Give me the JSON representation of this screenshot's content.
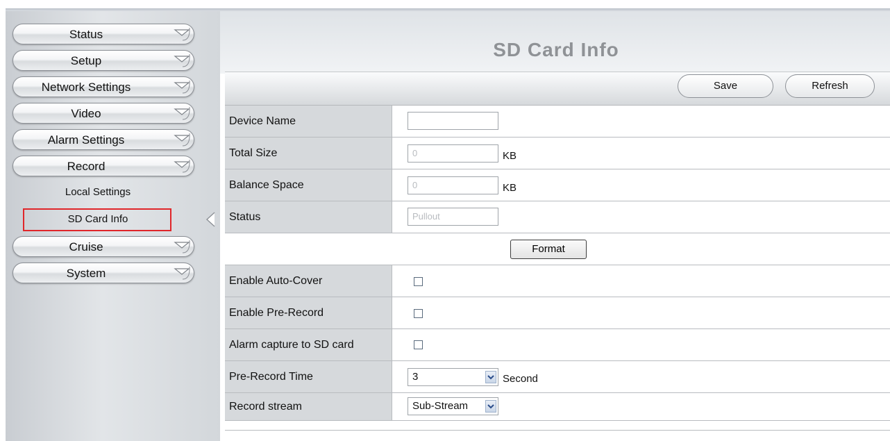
{
  "sidebar": {
    "menu": [
      {
        "label": "Status"
      },
      {
        "label": "Setup"
      },
      {
        "label": "Network Settings"
      },
      {
        "label": "Video"
      },
      {
        "label": "Alarm Settings"
      },
      {
        "label": "Record"
      },
      {
        "label": "Cruise"
      },
      {
        "label": "System"
      }
    ],
    "record_sub": [
      {
        "label": "Local Settings"
      },
      {
        "label": "SD Card Info",
        "selected": true
      }
    ]
  },
  "page": {
    "title": "SD Card Info",
    "save_label": "Save",
    "refresh_label": "Refresh"
  },
  "form": {
    "device_name": {
      "label": "Device Name",
      "value": ""
    },
    "total_size": {
      "label": "Total Size",
      "value": "0",
      "unit": "KB"
    },
    "balance_space": {
      "label": "Balance Space",
      "value": "0",
      "unit": "KB"
    },
    "status": {
      "label": "Status",
      "value": "Pullout"
    },
    "format_label": "Format",
    "auto_cover": {
      "label": "Enable Auto-Cover",
      "checked": false
    },
    "pre_record": {
      "label": "Enable Pre-Record",
      "checked": false
    },
    "alarm_capture": {
      "label": "Alarm capture to SD card",
      "checked": false
    },
    "pre_record_time": {
      "label": "Pre-Record Time",
      "value": "3",
      "unit": "Second"
    },
    "record_stream": {
      "label": "Record stream",
      "value": "Sub-Stream"
    }
  },
  "colors": {
    "selection_border": "#e0262a",
    "title": "#8f9296"
  }
}
